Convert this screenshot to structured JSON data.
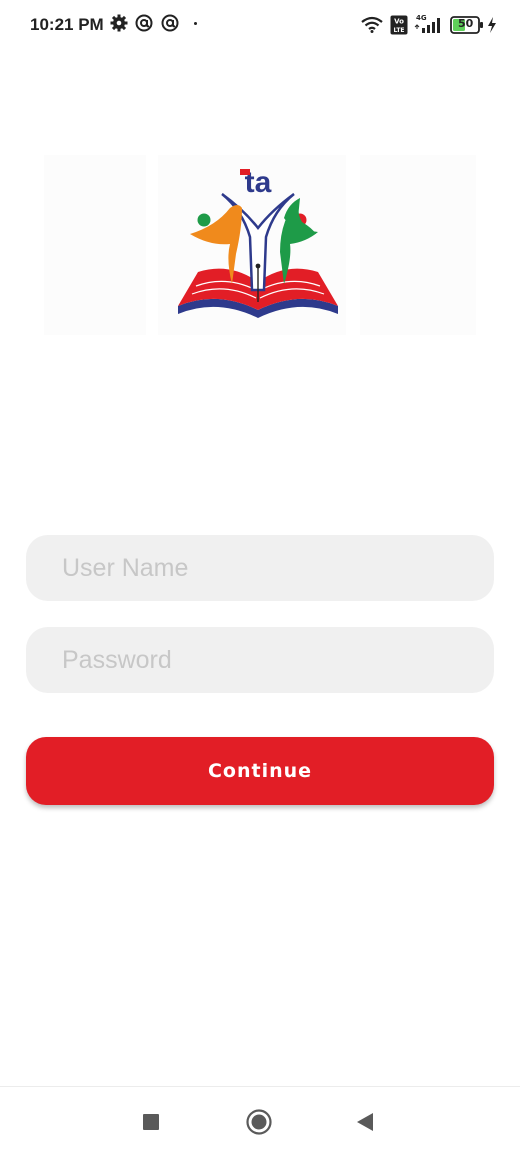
{
  "status_bar": {
    "time": "10:21 PM",
    "network_badge": "Vo LTE",
    "network_type": "4G",
    "battery_level": "50",
    "icons": [
      "settings-icon",
      "at-sign-icon",
      "at-sign-icon",
      "dot-icon",
      "wifi-icon",
      "volte-icon",
      "signal-icon",
      "battery-icon",
      "charging-icon"
    ]
  },
  "logo": {
    "letters": "ta",
    "icon": "education-logo"
  },
  "login": {
    "username_placeholder": "User Name",
    "password_placeholder": "Password",
    "continue_label": "Continue"
  },
  "nav_bar": {
    "items": [
      "recents-button",
      "home-button",
      "back-button"
    ]
  },
  "colors": {
    "primary": "#e21e26",
    "field_bg": "#f0f0f0",
    "placeholder": "#c7c7c7",
    "logo_orange": "#f08a1c",
    "logo_green": "#1e9b48",
    "logo_navy": "#2e3a8c"
  }
}
